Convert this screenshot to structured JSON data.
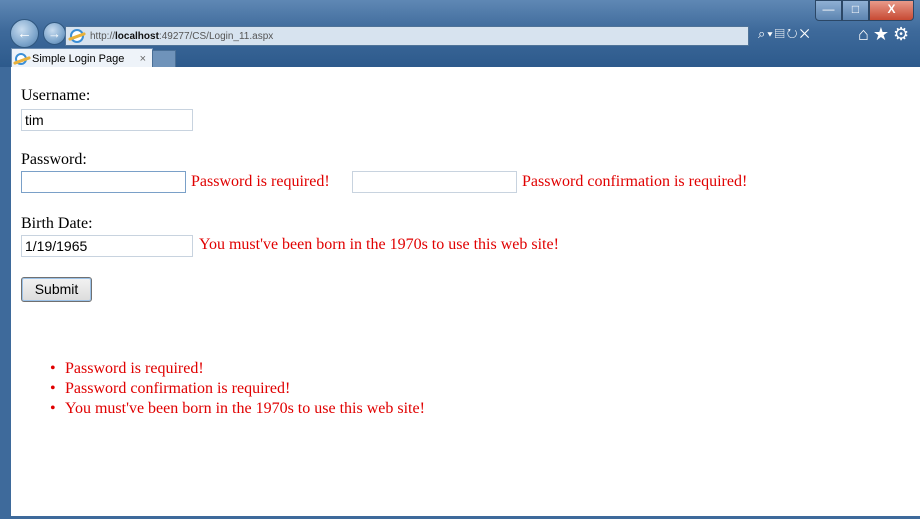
{
  "browser": {
    "url_prefix": "http://",
    "url_host": "localhost",
    "url_rest": ":49277/CS/Login_11.aspx",
    "tab_title": "Simple Login Page",
    "tab_close": "×",
    "window_buttons": {
      "minimize": "—",
      "maximize": "□",
      "close": "X"
    },
    "icons": [
      "back-icon",
      "forward-icon",
      "search-icon",
      "compatibility-icon",
      "refresh-icon",
      "stop-icon",
      "home-icon",
      "favorites-icon",
      "tools-icon"
    ]
  },
  "form": {
    "username_label": "Username:",
    "username_value": "tim",
    "password_label": "Password:",
    "password_value": "",
    "password_error": "Password is required!",
    "confirm_value": "",
    "confirm_error": "Password confirmation is required!",
    "birth_label": "Birth Date:",
    "birth_value": "1/19/1965",
    "birth_error": "You must've been born in the 1970s to use this web site!",
    "submit_label": "Submit"
  },
  "summary": [
    "Password is required!",
    "Password confirmation is required!",
    "You must've been born in the 1970s to use this web site!"
  ],
  "colors": {
    "error": "#e00000",
    "chrome": "#3e6a9b"
  }
}
